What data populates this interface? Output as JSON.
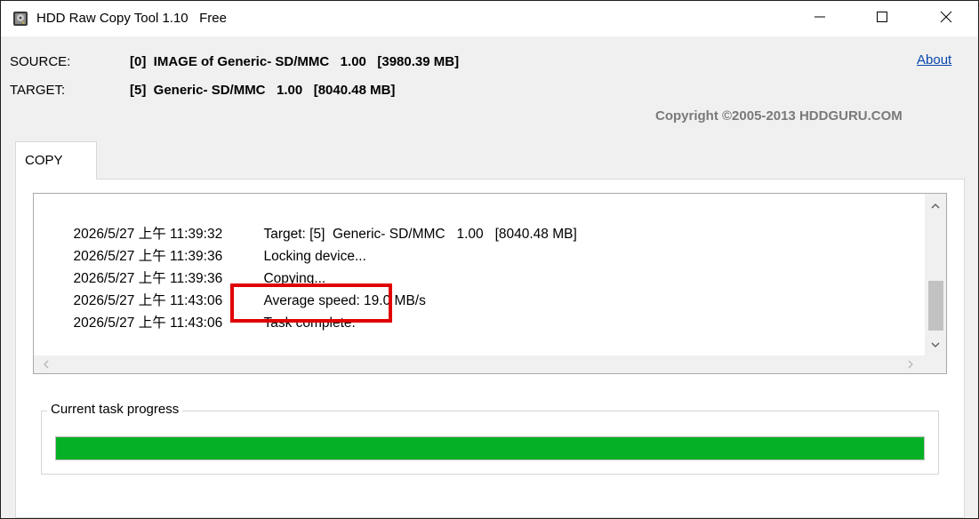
{
  "window": {
    "title": "HDD Raw Copy Tool 1.10   Free",
    "icon": "hdd-app-icon",
    "controls": {
      "minimize": "minimize-icon",
      "maximize": "maximize-icon",
      "close": "close-icon"
    }
  },
  "header": {
    "source_label": "SOURCE:",
    "source_value": "[0]  IMAGE of Generic- SD/MMC   1.00   [3980.39 MB]",
    "target_label": "TARGET:",
    "target_value": "[5]  Generic- SD/MMC   1.00   [8040.48 MB]",
    "about_link": "About",
    "copyright": "Copyright ©2005-2013 HDDGURU.COM"
  },
  "tabs": [
    {
      "label": "COPY",
      "active": true
    }
  ],
  "log": {
    "lines": [
      {
        "timestamp": "2026/5/27 上午 11:39:32",
        "message": "Target: [5]  Generic- SD/MMC   1.00   [8040.48 MB]"
      },
      {
        "timestamp": "2026/5/27 上午 11:39:36",
        "message": "Locking device..."
      },
      {
        "timestamp": "2026/5/27 上午 11:39:36",
        "message": "Copying..."
      },
      {
        "timestamp": "2026/5/27 上午 11:43:06",
        "message": "Average speed: 19.0 MB/s"
      },
      {
        "timestamp": "2026/5/27 上午 11:43:06",
        "message": "Task complete."
      }
    ]
  },
  "progress": {
    "label": "Current task progress",
    "value_percent": 100,
    "color": "#06b025"
  },
  "colors": {
    "highlight": "#e00000",
    "link": "#0645ad",
    "copyright": "#7a7a7a"
  }
}
